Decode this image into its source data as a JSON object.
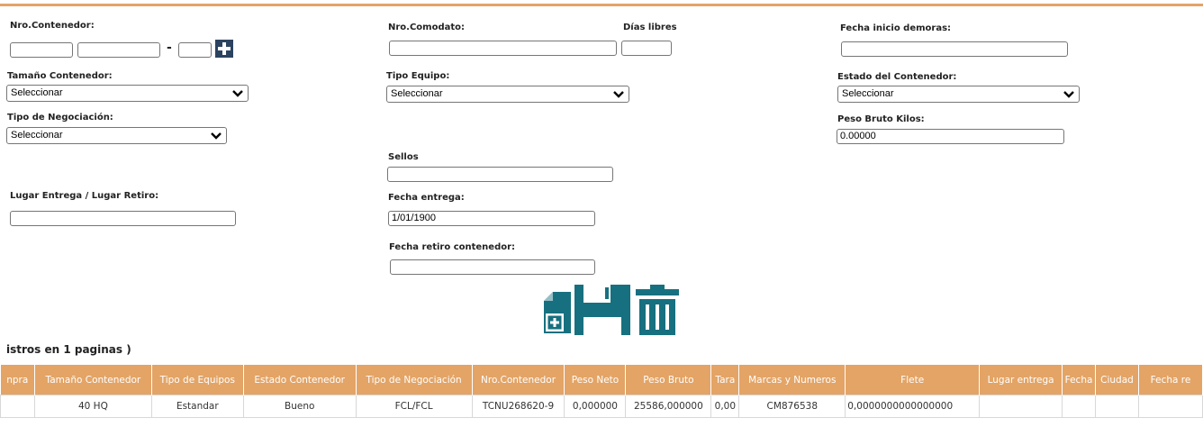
{
  "form": {
    "nro_contenedor": {
      "label": "Nro.Contenedor:",
      "part1": "",
      "part2": "",
      "part3": "",
      "separator": "-"
    },
    "nro_comodato": {
      "label": "Nro.Comodato:",
      "value": ""
    },
    "dias_libres": {
      "label": "Días libres",
      "value": ""
    },
    "fecha_inicio_demoras": {
      "label": "Fecha inicio demoras:",
      "value": ""
    },
    "tamano_contenedor": {
      "label": "Tamaño Contenedor:",
      "selected": "Seleccionar"
    },
    "tipo_equipo": {
      "label": "Tipo Equipo:",
      "selected": "Seleccionar"
    },
    "estado_contenedor": {
      "label": "Estado del Contenedor:",
      "selected": "Seleccionar"
    },
    "tipo_negociacion": {
      "label": "Tipo de Negociación:",
      "selected": "Seleccionar"
    },
    "peso_bruto_kilos": {
      "label": "Peso Bruto Kilos:",
      "value": "0.00000"
    },
    "sellos": {
      "label": "Sellos",
      "value": ""
    },
    "lugar_entrega": {
      "label": "Lugar Entrega / Lugar Retiro:",
      "value": ""
    },
    "fecha_entrega": {
      "label": "Fecha entrega:",
      "value": "1/01/1900"
    },
    "fecha_retiro": {
      "label": "Fecha retiro contenedor:",
      "value": ""
    }
  },
  "icons": {
    "add": "add-file-icon",
    "save": "floppy-disk-icon",
    "delete": "trash-icon",
    "accent": "#17707f",
    "header_bg": "#e3a466",
    "plus_bg": "#2c4360"
  },
  "records_text": "istros en 1 paginas )",
  "table": {
    "columns": [
      "npra",
      "Tamaño Contenedor",
      "Tipo de Equipos",
      "Estado Contenedor",
      "Tipo de Negociación",
      "Nro.Contenedor",
      "Peso Neto",
      "Peso Bruto",
      "Tara",
      "Marcas y Numeros",
      "Flete",
      "Lugar entrega",
      "Fecha",
      "Ciudad",
      "Fecha re"
    ],
    "rows": [
      [
        "",
        "40 HQ",
        "Estandar",
        "Bueno",
        "FCL/FCL",
        "TCNU268620-9",
        "0,000000",
        "25586,000000",
        "0,00",
        "CM876538",
        "0,0000000000000000",
        "",
        "",
        "",
        ""
      ]
    ]
  }
}
